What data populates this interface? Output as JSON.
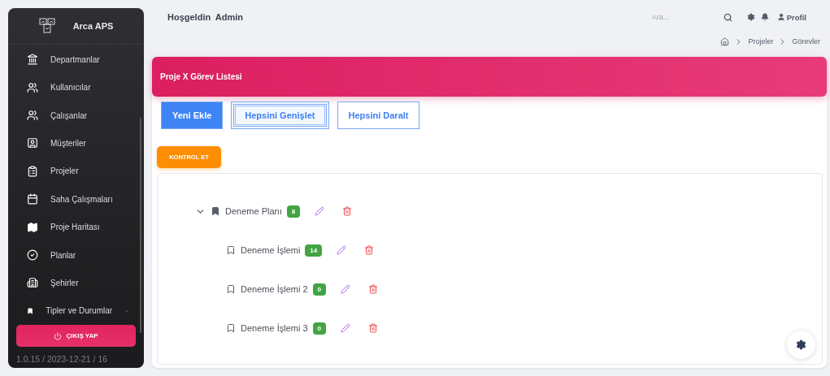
{
  "sidebar": {
    "brand": "Arca APS",
    "items": [
      {
        "label": "Departmanlar",
        "kind": "link"
      },
      {
        "label": "Kullanıcılar",
        "kind": "link"
      },
      {
        "label": "Çalışanlar",
        "kind": "link"
      },
      {
        "label": "Müşteriler",
        "kind": "link"
      },
      {
        "label": "Projeler",
        "kind": "link"
      },
      {
        "label": "Saha Çalışmaları",
        "kind": "link"
      },
      {
        "label": "Proje Haritası",
        "kind": "link"
      },
      {
        "label": "Planlar",
        "kind": "link"
      },
      {
        "label": "Şehirler",
        "kind": "link"
      },
      {
        "label": "Tipler ve Durumlar",
        "kind": "group"
      }
    ],
    "logout": "ÇIKIŞ YAP",
    "version": "1.0.15 / 2023-12-21 / 16"
  },
  "header": {
    "greeting": "Hoşgeldin  Admin",
    "search": {
      "placeholder": "Ara..."
    },
    "profile": "Profil"
  },
  "breadcrumb": [
    "Projeler",
    "Görevler"
  ],
  "panel": {
    "title": "Proje X Görev Listesi",
    "buttons": [
      {
        "label": "Yeni Ekle",
        "kind": "primary",
        "focused": false
      },
      {
        "label": "Hepsini Genişlet",
        "kind": "outline",
        "focused": true
      },
      {
        "label": "Hepsini Daralt",
        "kind": "outline",
        "focused": false
      }
    ],
    "check_button": "KONTROL ET",
    "tree": [
      {
        "label": "Deneme Planı",
        "count": "8",
        "expanded": true,
        "children": [
          {
            "label": "Deneme İşlemi",
            "count": "14"
          },
          {
            "label": "Deneme İşlemi 2",
            "count": "0"
          },
          {
            "label": "Deneme İşlemi 3",
            "count": "0"
          }
        ]
      }
    ]
  }
}
